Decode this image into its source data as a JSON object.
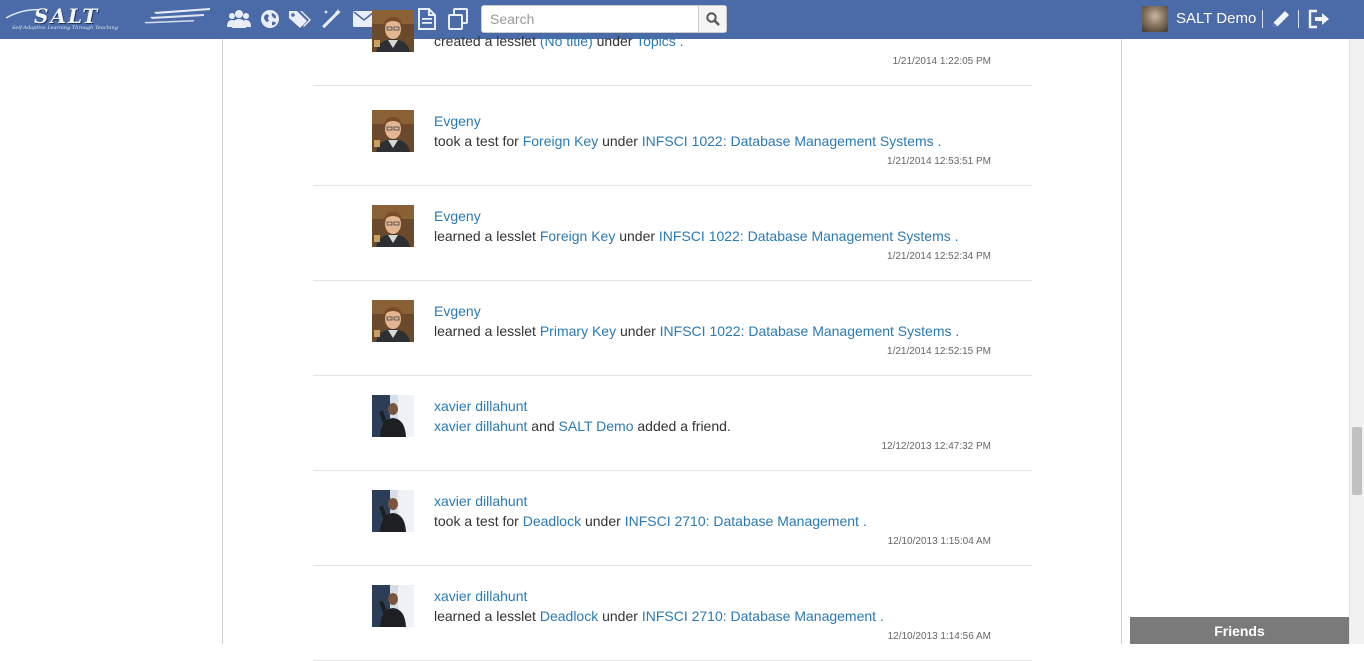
{
  "header": {
    "logo_text": "SALT",
    "logo_tagline": "Self-Adaptive Learning Through Teaching",
    "nav_icons": [
      "users-icon",
      "globe-icon",
      "tags-icon",
      "magic-wand-icon",
      "envelope-icon",
      "edit-icon",
      "document-icon",
      "copy-icon"
    ],
    "search_placeholder": "Search",
    "user_name": "SALT Demo",
    "brand_color": "#4b6aa8"
  },
  "feed": [
    {
      "user": "",
      "avatar": "evgeny",
      "parts": [
        {
          "t": "created a lesslet ",
          "link": false
        },
        {
          "t": "(No title)",
          "link": true
        },
        {
          "t": " under ",
          "link": false
        },
        {
          "t": "Topics",
          "link": true
        },
        {
          "t": " .",
          "link": true
        }
      ],
      "time": "1/21/2014 1:22:05 PM"
    },
    {
      "user": "Evgeny",
      "avatar": "evgeny",
      "parts": [
        {
          "t": "took a test for ",
          "link": false
        },
        {
          "t": "Foreign Key",
          "link": true
        },
        {
          "t": " under ",
          "link": false
        },
        {
          "t": "INFSCI 1022: Database Management Systems",
          "link": true
        },
        {
          "t": " .",
          "link": true
        }
      ],
      "time": "1/21/2014 12:53:51 PM"
    },
    {
      "user": "Evgeny",
      "avatar": "evgeny",
      "parts": [
        {
          "t": "learned a lesslet ",
          "link": false
        },
        {
          "t": "Foreign Key",
          "link": true
        },
        {
          "t": " under ",
          "link": false
        },
        {
          "t": "INFSCI 1022: Database Management Systems",
          "link": true
        },
        {
          "t": " .",
          "link": true
        }
      ],
      "time": "1/21/2014 12:52:34 PM"
    },
    {
      "user": "Evgeny",
      "avatar": "evgeny",
      "parts": [
        {
          "t": "learned a lesslet ",
          "link": false
        },
        {
          "t": "Primary Key",
          "link": true
        },
        {
          "t": " under ",
          "link": false
        },
        {
          "t": "INFSCI 1022: Database Management Systems",
          "link": true
        },
        {
          "t": " .",
          "link": true
        }
      ],
      "time": "1/21/2014 12:52:15 PM"
    },
    {
      "user": "xavier dillahunt",
      "avatar": "xavier",
      "parts": [
        {
          "t": "xavier dillahunt",
          "link": true
        },
        {
          "t": " and ",
          "link": false
        },
        {
          "t": "SALT Demo",
          "link": true
        },
        {
          "t": " added a friend.",
          "link": false
        }
      ],
      "time": "12/12/2013 12:47:32 PM"
    },
    {
      "user": "xavier dillahunt",
      "avatar": "xavier",
      "parts": [
        {
          "t": "took a test for ",
          "link": false
        },
        {
          "t": "Deadlock",
          "link": true
        },
        {
          "t": " under ",
          "link": false
        },
        {
          "t": "INFSCI 2710: Database Management",
          "link": true
        },
        {
          "t": " .",
          "link": true
        }
      ],
      "time": "12/10/2013 1:15:04 AM"
    },
    {
      "user": "xavier dillahunt",
      "avatar": "xavier",
      "parts": [
        {
          "t": "learned a lesslet ",
          "link": false
        },
        {
          "t": "Deadlock",
          "link": true
        },
        {
          "t": " under ",
          "link": false
        },
        {
          "t": "INFSCI 2710: Database Management",
          "link": true
        },
        {
          "t": " .",
          "link": true
        }
      ],
      "time": "12/10/2013 1:14:56 AM"
    }
  ],
  "friends_tab": "Friends"
}
